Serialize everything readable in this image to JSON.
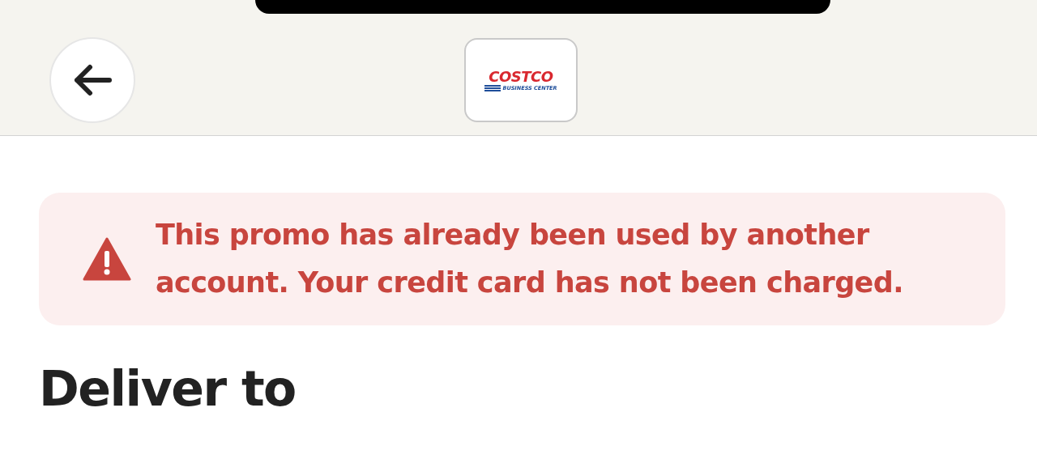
{
  "header": {
    "logo": {
      "title": "COSTCO",
      "subtitle": "BUSINESS CENTER"
    }
  },
  "alert": {
    "message": "This promo has already been used by another account. Your credit card has not been charged."
  },
  "section": {
    "title": "Deliver to"
  }
}
